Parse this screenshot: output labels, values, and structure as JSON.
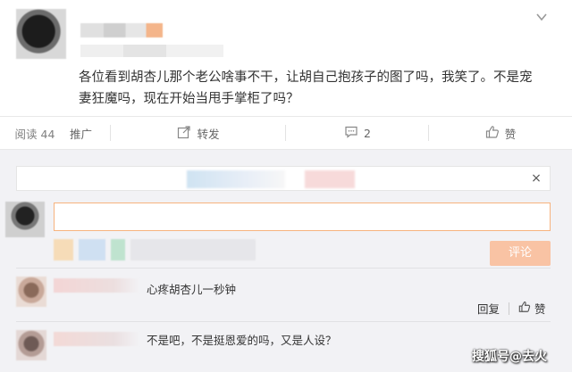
{
  "post": {
    "text": "各位看到胡杏儿那个老公啥事不干，让胡自己抱孩子的图了吗，我笑了。不是宠妻狂魔吗，现在开始当甩手掌柜了吗？"
  },
  "actions": {
    "read": "阅读 44",
    "promote": "推广",
    "forward": "转发",
    "comment_count": "2",
    "like": "赞"
  },
  "comment_box": {
    "submit_label": "评论",
    "close_symbol": "×"
  },
  "replies": [
    {
      "text": "心疼胡杏儿一秒钟",
      "reply_label": "回复",
      "like_label": "赞"
    },
    {
      "text": "不是吧，不是挺恩爱的吗，又是人设？"
    }
  ],
  "watermark": "搜狐号@去火",
  "icons": {
    "menu": "chevron-down-icon",
    "forward": "share-icon",
    "comment": "comment-icon",
    "like": "thumbs-up-icon"
  },
  "colors": {
    "accent_orange": "#f7b37e",
    "submit_bg": "#f9c3a4",
    "comment_area_bg": "#f2f2f5"
  }
}
